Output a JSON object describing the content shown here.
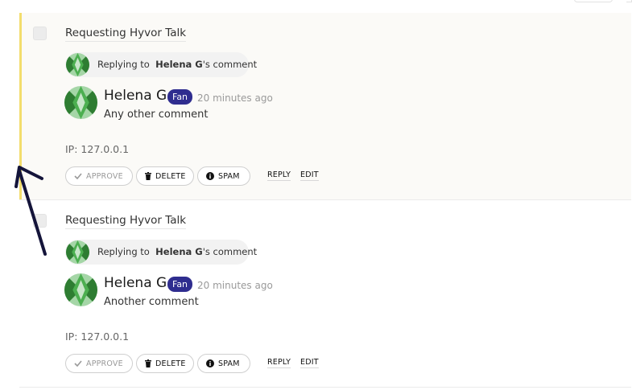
{
  "comments": [
    {
      "page_title": "Requesting Hyvor Talk",
      "reply_prefix": "Replying to",
      "reply_name": "Helena G",
      "reply_suffix": "'s comment",
      "author": "Helena G",
      "badge": "Fan",
      "time": "20 minutes ago",
      "body": "Any other comment",
      "ip_label": "IP:",
      "ip": "127.0.0.1",
      "actions": {
        "approve": "APPROVE",
        "delete": "DELETE",
        "spam": "SPAM",
        "reply": "REPLY",
        "edit": "EDIT"
      }
    },
    {
      "page_title": "Requesting Hyvor Talk",
      "reply_prefix": "Replying to",
      "reply_name": "Helena G",
      "reply_suffix": "'s comment",
      "author": "Helena G",
      "badge": "Fan",
      "time": "20 minutes ago",
      "body": "Another comment",
      "ip_label": "IP:",
      "ip": "127.0.0.1",
      "actions": {
        "approve": "APPROVE",
        "delete": "DELETE",
        "spam": "SPAM",
        "reply": "REPLY",
        "edit": "EDIT"
      }
    }
  ],
  "colors": {
    "accent_bar": "#f3dd6d",
    "badge_bg": "#2f2d8f",
    "avatar_dark": "#2e7d32",
    "avatar_mid": "#4caf50",
    "avatar_light": "#a5d6a7",
    "annotation_arrow": "#14143a"
  },
  "icons": {
    "approve": "check-icon",
    "delete": "trash-icon",
    "spam": "info-icon"
  }
}
